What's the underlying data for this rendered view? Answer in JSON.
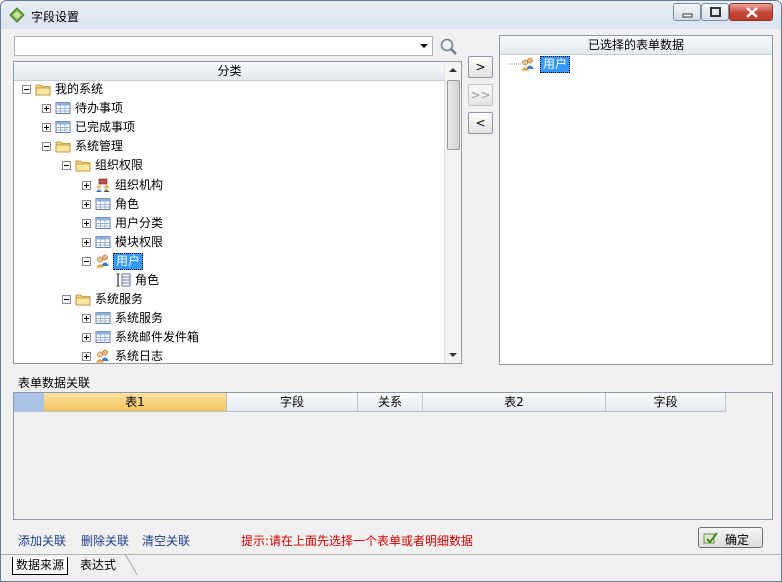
{
  "window": {
    "title": "字段设置"
  },
  "search": {
    "value": ""
  },
  "left_panel": {
    "header": "分类",
    "tree": [
      {
        "label": "我的系统",
        "icon": "folder-icon",
        "level": 0,
        "expander": "minus"
      },
      {
        "label": "待办事项",
        "icon": "table-icon",
        "level": 1,
        "expander": "plus"
      },
      {
        "label": "已完成事项",
        "icon": "table-icon",
        "level": 1,
        "expander": "plus"
      },
      {
        "label": "系统管理",
        "icon": "folder-icon",
        "level": 1,
        "expander": "minus"
      },
      {
        "label": "组织权限",
        "icon": "folder-icon",
        "level": 2,
        "expander": "minus"
      },
      {
        "label": "组织机构",
        "icon": "org-icon",
        "level": 3,
        "expander": "plus"
      },
      {
        "label": "角色",
        "icon": "table-icon",
        "level": 3,
        "expander": "plus"
      },
      {
        "label": "用户分类",
        "icon": "table-icon",
        "level": 3,
        "expander": "plus"
      },
      {
        "label": "模块权限",
        "icon": "table-icon",
        "level": 3,
        "expander": "plus"
      },
      {
        "label": "用户",
        "icon": "users-icon",
        "level": 3,
        "expander": "minus",
        "selected": true
      },
      {
        "label": "角色",
        "icon": "field-icon",
        "level": 4,
        "expander": "none"
      },
      {
        "label": "系统服务",
        "icon": "folder-icon",
        "level": 2,
        "expander": "minus"
      },
      {
        "label": "系统服务",
        "icon": "table-icon",
        "level": 3,
        "expander": "plus"
      },
      {
        "label": "系统邮件发件箱",
        "icon": "table-icon",
        "level": 3,
        "expander": "plus"
      },
      {
        "label": "系统日志",
        "icon": "users-icon",
        "level": 3,
        "expander": "plus"
      }
    ]
  },
  "move_buttons": {
    "add": ">",
    "add_all": ">>",
    "remove": "<"
  },
  "right_panel": {
    "header": "已选择的表单数据",
    "items": [
      {
        "label": "用户",
        "icon": "users-icon"
      }
    ]
  },
  "relations": {
    "section_label": "表单数据关联",
    "columns": [
      "表1",
      "字段",
      "关系",
      "表2",
      "字段"
    ]
  },
  "actions": {
    "add": "添加关联",
    "delete": "删除关联",
    "clear": "清空关联",
    "hint": "提示:请在上面先选择一个表单或者明细数据",
    "ok": "确定"
  },
  "tabs": {
    "data_source": "数据来源",
    "expression": "表达式"
  }
}
